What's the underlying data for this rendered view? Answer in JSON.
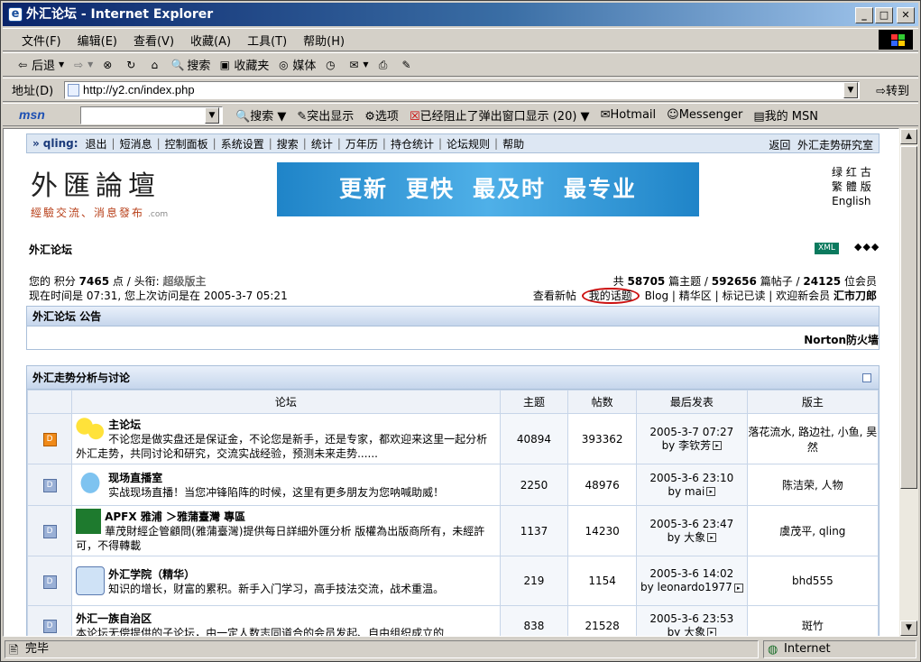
{
  "window": {
    "title": "外汇论坛 - Internet Explorer",
    "ie_icon": "e"
  },
  "menu": [
    "文件(F)",
    "编辑(E)",
    "查看(V)",
    "收藏(A)",
    "工具(T)",
    "帮助(H)"
  ],
  "toolbar": {
    "back": "后退",
    "search": "搜索",
    "favorites": "收藏夹",
    "media": "媒体"
  },
  "address": {
    "label": "地址(D)",
    "url": "http://y2.cn/index.php",
    "go": "转到"
  },
  "msn": {
    "logo": "msn",
    "search": "搜索",
    "highlight": "突出显示",
    "options": "选项",
    "popup": "已经阻止了弹出窗口显示 (20)",
    "hotmail": "Hotmail",
    "messenger": "Messenger",
    "mymsn": "我的 MSN"
  },
  "nav": {
    "prefix": "»",
    "user": "qling:",
    "items": [
      "退出",
      "短消息",
      "控制面板",
      "系统设置",
      "搜索",
      "统计",
      "万年历",
      "持仓统计",
      "论坛规则",
      "帮助"
    ],
    "back": "返回",
    "right_link": "外汇走势研究室"
  },
  "logo": {
    "title": "外匯論壇",
    "slogan": "經驗交流、消息發布",
    "com": ".com"
  },
  "banner": [
    "更新",
    "更快",
    "最及时",
    "最专业"
  ],
  "lang": [
    "绿",
    "红",
    "古",
    "繁",
    "體",
    "版",
    "English"
  ],
  "forum_title": "外汇论坛",
  "xml": "XML",
  "arrows": "◆◆◆",
  "user": {
    "points_prefix": "您的 积分",
    "points": "7465",
    "points_unit": "点 / 头衔:",
    "rank": "超级版主",
    "time_text": "现在时间是 07:31, 您上次访问是在 2005-3-7 05:21"
  },
  "stats": {
    "p1": "共",
    "topics": "58705",
    "p2": "篇主题 /",
    "posts": "592656",
    "p3": "篇帖子 /",
    "members": "24125",
    "p4": "位会员"
  },
  "links": {
    "new": "查看新帖",
    "mine": "我的话题",
    "blog": "Blog",
    "digest": "精华区",
    "mark": "标记已读",
    "welcome": "欢迎新会员",
    "newmember": "汇市刀郎"
  },
  "announce": {
    "title": "外汇论坛 公告",
    "marquee": "Norton防火墙"
  },
  "category": {
    "title": "外汇走势分析与讨论",
    "headers": [
      "论坛",
      "主题",
      "帖数",
      "最后发表",
      "版主"
    ],
    "rows": [
      {
        "icon": "D",
        "name": "主论坛",
        "desc": "不论您是做实盘还是保证金，不论您是新手，还是专家，都欢迎来这里一起分析外汇走势，共同讨论和研究，交流实战经验，预测未来走势......",
        "topics": "40894",
        "posts": "393362",
        "last_date": "2005-3-7 07:27",
        "last_by": "by 李钦芳",
        "mods": "落花流水, 路边社, 小鱼, 昊然"
      },
      {
        "icon": "D",
        "name": "现场直播室",
        "desc": "实战现场直播！当您冲锋陷阵的时候，这里有更多朋友为您呐喊助威！",
        "topics": "2250",
        "posts": "48976",
        "last_date": "2005-3-6 23:10",
        "last_by": "by mai",
        "mods": "陈洁荣, 人物"
      },
      {
        "icon": "D",
        "name": "APFX 雅浦 ＞雅蒲臺灣 專區",
        "desc": "華茂財經企管顧問(雅蒲臺灣)提供每日詳細外匯分析 版權為出版商所有，未經許可，不得轉載",
        "topics": "1137",
        "posts": "14230",
        "last_date": "2005-3-6 23:47",
        "last_by": "by 大象",
        "mods": "虞茂平, qling"
      },
      {
        "icon": "D",
        "name": "外汇学院（精华）",
        "desc": "知识的增长，财富的累积。新手入门学习，高手技法交流，战术重温。",
        "topics": "219",
        "posts": "1154",
        "last_date": "2005-3-6 14:02",
        "last_by": "by leonardo1977",
        "mods": "bhd555"
      },
      {
        "icon": "D",
        "name": "外汇一族自治区",
        "desc": "本论坛无偿提供的子论坛，由一定人数志同道合的会员发起、自由组织成立的",
        "topics": "838",
        "posts": "21528",
        "last_date": "2005-3-6 23:53",
        "last_by": "by 大象",
        "mods": "斑竹"
      }
    ]
  },
  "status": {
    "left": "完毕",
    "right": "Internet"
  }
}
